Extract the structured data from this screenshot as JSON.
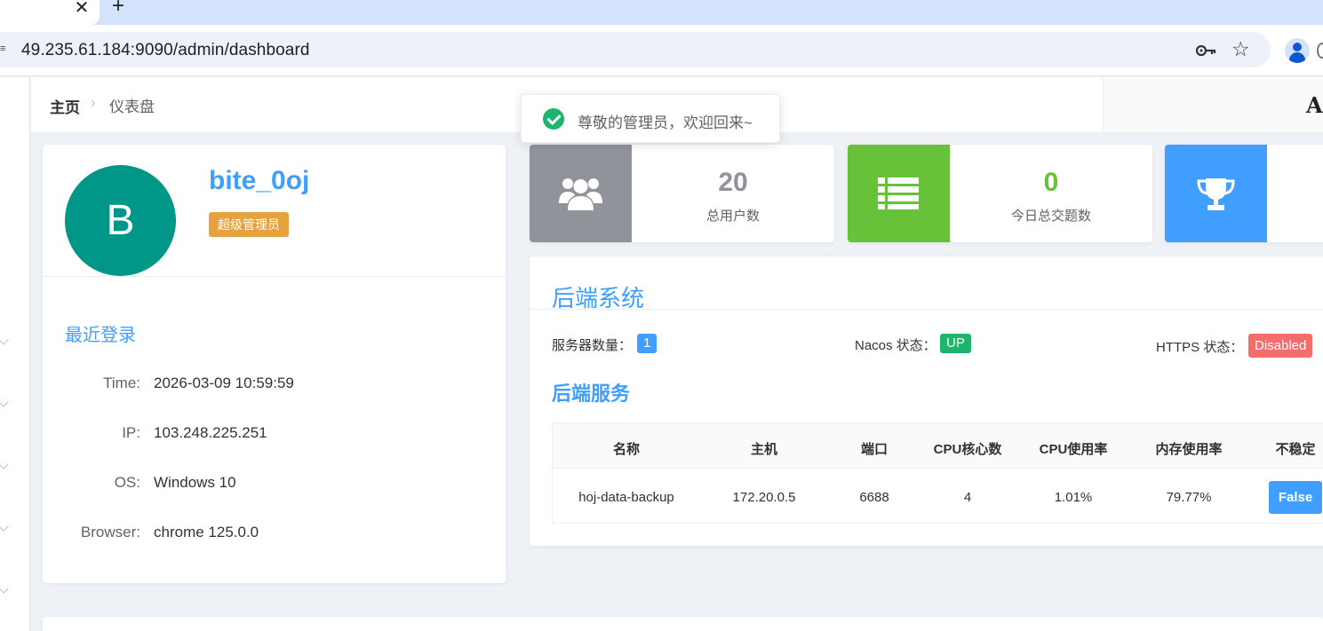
{
  "browser": {
    "tab_close": "✕",
    "new_tab": "+",
    "site_icon": "≡",
    "url": "49.235.61.184:9090/admin/dashboard",
    "icons": [
      "key-icon",
      "star-icon",
      "profile-icon",
      "menu-icon"
    ]
  },
  "breadcrumb": {
    "home": "主页",
    "separator": "›",
    "current": "仪表盘"
  },
  "topbar": {
    "right_letter": "A"
  },
  "toast": {
    "message": "尊敬的管理员，欢迎回来~",
    "color": "#1db46d"
  },
  "profile": {
    "avatar_letter": "B",
    "avatar_color": "#009688",
    "username": "bite_0oj",
    "role": "超级管理员",
    "recent_login_title": "最近登录",
    "login": [
      {
        "label": "Time:",
        "value": "2026-03-09 10:59:59"
      },
      {
        "label": "IP:",
        "value": "103.248.225.251"
      },
      {
        "label": "OS:",
        "value": "Windows 10"
      },
      {
        "label": "Browser:",
        "value": "chrome 125.0.0"
      }
    ]
  },
  "stats": [
    {
      "value": "20",
      "label": "总用户数",
      "icon": "users-icon",
      "color": "#909399"
    },
    {
      "value": "0",
      "label": "今日总交题数",
      "icon": "list-icon",
      "color": "#67c23a"
    },
    {
      "value": "",
      "label": "",
      "icon": "trophy-icon",
      "color": "#409eff"
    }
  ],
  "backend": {
    "title": "后端系统",
    "server_count_label": "服务器数量：",
    "server_count": "1",
    "nacos_label": "Nacos 状态：",
    "nacos_status": "UP",
    "https_label": "HTTPS 状态：",
    "https_status": "Disabled",
    "services_title": "后端服务",
    "columns": [
      "名称",
      "主机",
      "端口",
      "CPU核心数",
      "CPU使用率",
      "内存使用率",
      "不稳定"
    ],
    "rows": [
      {
        "name": "hoj-data-backup",
        "host": "172.20.0.5",
        "port": "6688",
        "cores": "4",
        "cpu": "1.01%",
        "memory": "79.77%",
        "unstable": "False"
      }
    ]
  }
}
